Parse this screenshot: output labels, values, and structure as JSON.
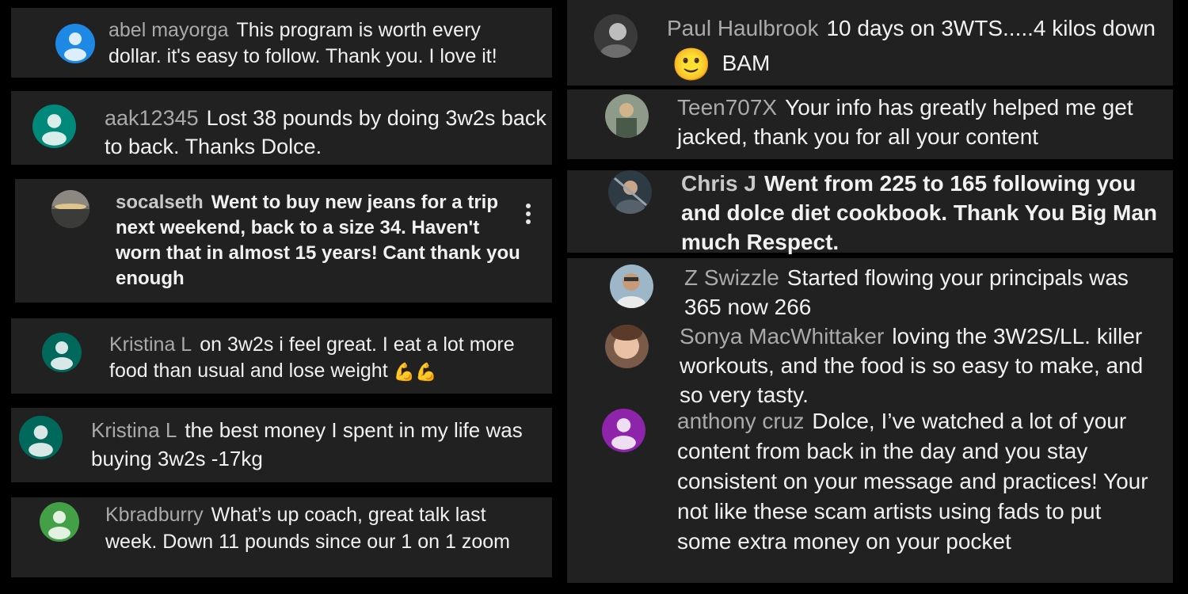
{
  "colors": {
    "background": "#000000",
    "card": "#212121",
    "author": "#aaaaaa",
    "text": "#f1f1f1",
    "avatar_blue": "#1e88e5",
    "avatar_teal": "#00897b",
    "avatar_darkgreen": "#00695c",
    "avatar_green": "#43a047",
    "avatar_purple": "#8e24aa"
  },
  "comments": [
    {
      "author": "abel mayorga",
      "text": "This program is worth every dollar. it's easy to follow. Thank you. I love it!",
      "avatar": "default-user-icon"
    },
    {
      "author": "aak12345",
      "text": "Lost 38 pounds by doing 3w2s back to back. Thanks Dolce.",
      "avatar": "default-user-icon"
    },
    {
      "author": "socalseth",
      "text": "Went to buy new jeans for a trip next weekend, back to a size 34. Haven't worn that in almost 15 years! Cant thank you enough",
      "avatar": "sunset-photo-avatar"
    },
    {
      "author": "Kristina L",
      "text": "on 3w2s i feel great. I eat a lot more food than usual and lose weight",
      "emoji": "💪💪",
      "avatar": "default-user-icon"
    },
    {
      "author": "Kristina L",
      "text": "the best money I spent in my life was buying 3w2s -17kg",
      "avatar": "default-user-icon"
    },
    {
      "author": "Kbradburry",
      "text": "What’s up coach, great talk last week. Down 11 pounds since our 1 on 1 zoom",
      "avatar": "default-user-icon"
    },
    {
      "author": "Paul Haulbrook",
      "text_before": "10 days on 3WTS.....4 kilos down",
      "emoji": "🙂",
      "text_after": "BAM",
      "avatar": "person-photo-avatar"
    },
    {
      "author": "Teen707X",
      "text": "Your info has greatly helped me get jacked, thank you for all your content",
      "avatar": "person-photo-avatar"
    },
    {
      "author": "Chris J",
      "text": "Went from 225 to 165 following you and dolce diet cookbook. Thank You Big Man much Respect.",
      "avatar": "person-photo-avatar"
    },
    {
      "author": "Z Swizzle",
      "text": "Started flowing your principals was 365 now 266",
      "avatar": "person-photo-avatar"
    },
    {
      "author": "Sonya MacWhittaker",
      "text": "loving the 3W2S/LL. killer workouts, and the food is so easy to make, and so very tasty.",
      "avatar": "person-photo-avatar"
    },
    {
      "author": "anthony cruz",
      "text": "Dolce, I’ve watched a lot of your content from back in the day and you stay consistent on your message and practices! Your not like these scam artists using fads to put some extra money on your pocket",
      "avatar": "default-user-icon"
    }
  ]
}
